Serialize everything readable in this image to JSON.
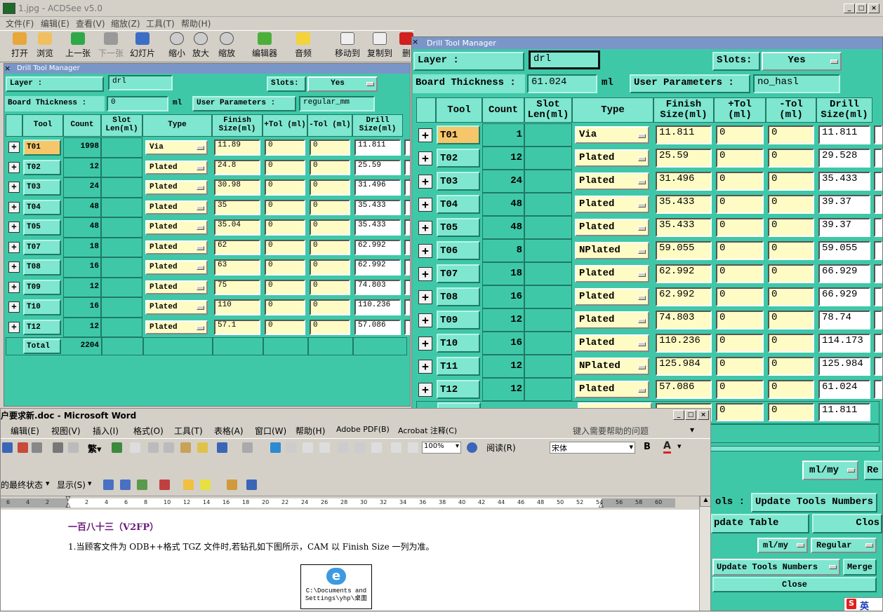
{
  "acdsee": {
    "title": "1.jpg - ACDSee v5.0",
    "menu": [
      "文件(F)",
      "编辑(E)",
      "查看(V)",
      "缩放(Z)",
      "工具(T)",
      "帮助(H)"
    ],
    "toolbar": [
      "打开",
      "浏览",
      "上一张",
      "下一张",
      "幻灯片",
      "缩小",
      "放大",
      "缩放",
      "编辑器",
      "音频",
      "移动到",
      "复制到",
      "删"
    ]
  },
  "dtm_left": {
    "title": "Drill Tool Manager",
    "layer_label": "Layer                :",
    "layer_value": "drl",
    "slots_label": "Slots:",
    "slots_value": "Yes",
    "thickness_label": "Board Thickness :",
    "thickness_value": "0",
    "thickness_unit": "ml",
    "user_params_label": "User Parameters :",
    "user_params_value": "regular_mm",
    "headers": [
      "Tool",
      "Count",
      "Slot Len(ml)",
      "Type",
      "Finish Size(ml)",
      "+Tol (ml)",
      "-Tol (ml)",
      "Drill Size(ml)"
    ],
    "rows": [
      {
        "tool": "T01",
        "count": "1998",
        "type": "Via",
        "finish": "11.89",
        "ptol": "0",
        "ntol": "0",
        "drill": "11.811"
      },
      {
        "tool": "T02",
        "count": "12",
        "type": "Plated",
        "finish": "24.8",
        "ptol": "0",
        "ntol": "0",
        "drill": "25.59"
      },
      {
        "tool": "T03",
        "count": "24",
        "type": "Plated",
        "finish": "30.98",
        "ptol": "0",
        "ntol": "0",
        "drill": "31.496"
      },
      {
        "tool": "T04",
        "count": "48",
        "type": "Plated",
        "finish": "35",
        "ptol": "0",
        "ntol": "0",
        "drill": "35.433"
      },
      {
        "tool": "T05",
        "count": "48",
        "type": "Plated",
        "finish": "35.04",
        "ptol": "0",
        "ntol": "0",
        "drill": "35.433"
      },
      {
        "tool": "T07",
        "count": "18",
        "type": "Plated",
        "finish": "62",
        "ptol": "0",
        "ntol": "0",
        "drill": "62.992"
      },
      {
        "tool": "T08",
        "count": "16",
        "type": "Plated",
        "finish": "63",
        "ptol": "0",
        "ntol": "0",
        "drill": "62.992"
      },
      {
        "tool": "T09",
        "count": "12",
        "type": "Plated",
        "finish": "75",
        "ptol": "0",
        "ntol": "0",
        "drill": "74.803"
      },
      {
        "tool": "T10",
        "count": "16",
        "type": "Plated",
        "finish": "110",
        "ptol": "0",
        "ntol": "0",
        "drill": "110.236"
      },
      {
        "tool": "T12",
        "count": "12",
        "type": "Plated",
        "finish": "57.1",
        "ptol": "0",
        "ntol": "0",
        "drill": "57.086"
      }
    ],
    "total_label": "Total",
    "total_value": "2204"
  },
  "dtm_right": {
    "title": "Drill Tool Manager",
    "layer_label": "Layer            :",
    "layer_value": "drl",
    "slots_label": "Slots:",
    "slots_value": "Yes",
    "thickness_label": "Board Thickness :",
    "thickness_value": "61.024",
    "thickness_unit": "ml",
    "user_params_label": "User Parameters :",
    "user_params_value": "no_hasl",
    "headers": [
      "Tool",
      "Count",
      "Slot Len(ml)",
      "Type",
      "Finish Size(ml)",
      "+Tol (ml)",
      "-Tol (ml)",
      "Drill Size(ml)"
    ],
    "rows": [
      {
        "tool": "T01",
        "count": "1",
        "type": "Via",
        "finish": "11.811",
        "ptol": "0",
        "ntol": "0",
        "drill": "11.811"
      },
      {
        "tool": "T02",
        "count": "12",
        "type": "Plated",
        "finish": "25.59",
        "ptol": "0",
        "ntol": "0",
        "drill": "29.528"
      },
      {
        "tool": "T03",
        "count": "24",
        "type": "Plated",
        "finish": "31.496",
        "ptol": "0",
        "ntol": "0",
        "drill": "35.433"
      },
      {
        "tool": "T04",
        "count": "48",
        "type": "Plated",
        "finish": "35.433",
        "ptol": "0",
        "ntol": "0",
        "drill": "39.37"
      },
      {
        "tool": "T05",
        "count": "48",
        "type": "Plated",
        "finish": "35.433",
        "ptol": "0",
        "ntol": "0",
        "drill": "39.37"
      },
      {
        "tool": "T06",
        "count": "8",
        "type": "NPlated",
        "finish": "59.055",
        "ptol": "0",
        "ntol": "0",
        "drill": "59.055"
      },
      {
        "tool": "T07",
        "count": "18",
        "type": "Plated",
        "finish": "62.992",
        "ptol": "0",
        "ntol": "0",
        "drill": "66.929"
      },
      {
        "tool": "T08",
        "count": "16",
        "type": "Plated",
        "finish": "62.992",
        "ptol": "0",
        "ntol": "0",
        "drill": "66.929"
      },
      {
        "tool": "T09",
        "count": "12",
        "type": "Plated",
        "finish": "74.803",
        "ptol": "0",
        "ntol": "0",
        "drill": "78.74"
      },
      {
        "tool": "T10",
        "count": "16",
        "type": "Plated",
        "finish": "110.236",
        "ptol": "0",
        "ntol": "0",
        "drill": "114.173"
      },
      {
        "tool": "T11",
        "count": "12",
        "type": "NPlated",
        "finish": "125.984",
        "ptol": "0",
        "ntol": "0",
        "drill": "125.984"
      },
      {
        "tool": "T12",
        "count": "12",
        "type": "Plated",
        "finish": "57.086",
        "ptol": "0",
        "ntol": "0",
        "drill": "61.024"
      }
    ],
    "partial_row": {
      "ptol": "0",
      "ntol": "0",
      "drill": "11.811"
    },
    "units_select": "ml/my",
    "re_button": "Re",
    "tools_label": "ols  :",
    "update_tools_numbers": "Update Tools Numbers",
    "update_table": "pdate Table",
    "close_partial": "Clos",
    "units_select2": "ml/my",
    "regular_select": "Regular",
    "update_tools_numbers2": "Update Tools Numbers",
    "merge": "Merge",
    "close": "Close"
  },
  "word": {
    "title": "户要求新.doc - Microsoft Word",
    "menu": [
      "编辑(E)",
      "视图(V)",
      "插入(I)",
      "格式(O)",
      "工具(T)",
      "表格(A)",
      "窗口(W)",
      "帮助(H)",
      "Adobe PDF(B)",
      "Acrobat 注释(C)"
    ],
    "help_placeholder": "键入需要帮助的问题",
    "zoom": "100%",
    "read_label": "阅读(R)",
    "font_name": "宋体",
    "markup_state": "的最终状态",
    "show_label": "显示(S)",
    "ruler_marks": [
      "6",
      "4",
      "2",
      "",
      "2",
      "4",
      "6",
      "8",
      "10",
      "12",
      "14",
      "16",
      "18",
      "20",
      "22",
      "24",
      "26",
      "28",
      "30",
      "32",
      "34",
      "36",
      "38",
      "40",
      "42",
      "44",
      "46",
      "48",
      "50",
      "52",
      "54",
      "56",
      "58",
      "60"
    ],
    "heading": "一百八十三（V2FP）",
    "paragraph": "1.当顾客文件为 ODB++格式 TGZ 文件时,若钻孔如下图所示，CAM 以 Finish Size 一列为准。",
    "embed_line1": "C:\\Documents and",
    "embed_line2": "Settings\\yhp\\桌面"
  },
  "tray": {
    "ime": "英"
  }
}
